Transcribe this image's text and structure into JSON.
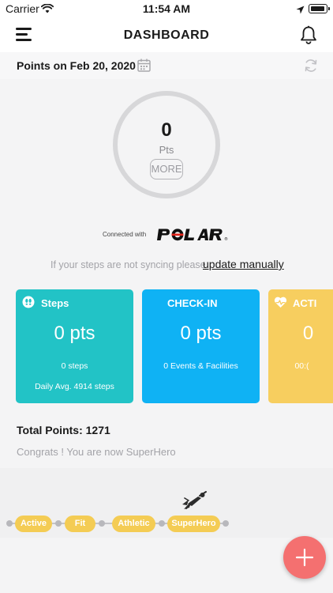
{
  "status_bar": {
    "carrier": "Carrier",
    "time": "11:54 AM"
  },
  "nav": {
    "title": "DASHBOARD",
    "icons": [
      "menu-icon",
      "bell-icon"
    ]
  },
  "points_header": {
    "date_label": "Points on Feb 20, 2020",
    "icons": [
      "calendar-icon",
      "refresh-icon"
    ]
  },
  "ring": {
    "value": "0",
    "unit": "Pts",
    "more_label": "MORE"
  },
  "connected": {
    "label": "Connected with",
    "brand": "POLAR"
  },
  "sync": {
    "text": "If your steps are not syncing please",
    "link": "update manually"
  },
  "cards": [
    {
      "title": "Steps",
      "points": "0 pts",
      "sub": "0 steps",
      "avg": "Daily Avg. 4914 steps",
      "color": "#22c3c6",
      "icon": "steps-icon"
    },
    {
      "title": "CHECK-IN",
      "points": "0 pts",
      "sub": "0 Events & Facilities",
      "color": "#0fb2f4"
    },
    {
      "title": "ACTI",
      "points": "0",
      "sub": "00:(",
      "color": "#f7ce5f",
      "icon": "heart-pulse-icon"
    }
  ],
  "total_points": "Total Points: 1271",
  "congrats": "Congrats ! You are now SuperHero",
  "levels": [
    {
      "label": "Active"
    },
    {
      "label": "Fit"
    },
    {
      "label": "Athletic"
    },
    {
      "label": "SuperHero"
    }
  ],
  "colors": {
    "accent_teal": "#22c3c6",
    "accent_blue": "#0fb2f4",
    "accent_yellow": "#f7ce5f",
    "level_pill": "#f4cc54",
    "fab": "#f47070"
  },
  "fab": {
    "icon": "plus-icon"
  }
}
